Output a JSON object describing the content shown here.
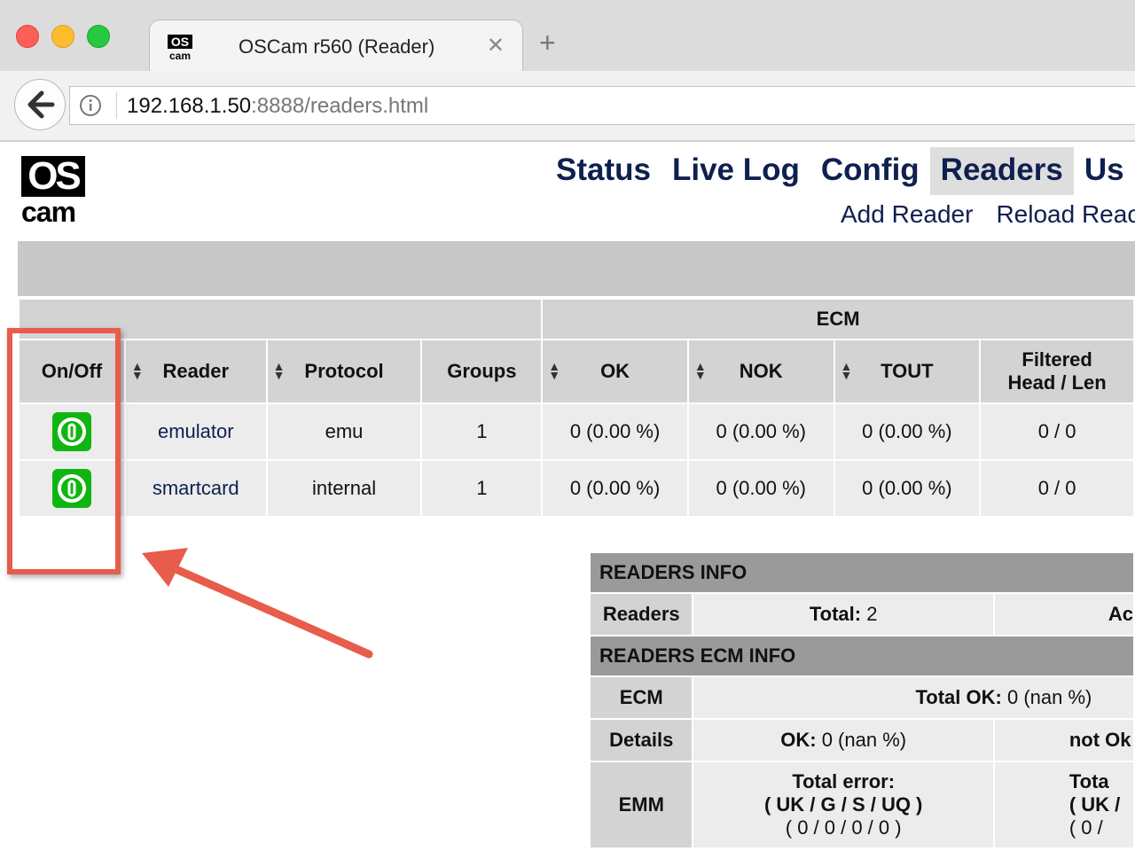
{
  "browser": {
    "tab_title": "OSCam r560 (Reader)",
    "tab_close_glyph": "✕",
    "new_tab_glyph": "+",
    "url_host": "192.168.1.50",
    "url_rest": ":8888/readers.html"
  },
  "logo": {
    "top": "OS",
    "bottom": "cam"
  },
  "nav": {
    "main": [
      "Status",
      "Live Log",
      "Config",
      "Readers",
      "Us"
    ],
    "active": "Readers",
    "sub": [
      "Add Reader",
      "Reload Reac"
    ]
  },
  "readers_table": {
    "group_header": "ECM",
    "columns": {
      "onoff": "On/Off",
      "reader": "Reader",
      "protocol": "Protocol",
      "groups": "Groups",
      "ok": "OK",
      "nok": "NOK",
      "tout": "TOUT",
      "filtered_line1": "Filtered",
      "filtered_line2": "Head / Len"
    },
    "rows": [
      {
        "reader": "emulator",
        "protocol": "emu",
        "groups": "1",
        "ok": "0 (0.00 %)",
        "nok": "0 (0.00 %)",
        "tout": "0 (0.00 %)",
        "filtered": "0 / 0"
      },
      {
        "reader": "smartcard",
        "protocol": "internal",
        "groups": "1",
        "ok": "0 (0.00 %)",
        "nok": "0 (0.00 %)",
        "tout": "0 (0.00 %)",
        "filtered": "0 / 0"
      }
    ]
  },
  "info": {
    "readers_info_title": "READERS INFO",
    "readers_label": "Readers",
    "readers_total_label": "Total:",
    "readers_total_value": "2",
    "readers_col3": "Ac",
    "ecm_info_title": "READERS ECM INFO",
    "ecm_label": "ECM",
    "ecm_total_ok_label": "Total OK:",
    "ecm_total_ok_value": "0 (nan %)",
    "details_label": "Details",
    "details_ok_label": "OK:",
    "details_ok_value": "0 (nan %)",
    "details_col3": "not Ok",
    "emm_label": "EMM",
    "emm_total_error": "Total error:",
    "emm_codes": "( UK / G / S / UQ )",
    "emm_values": "( 0 / 0 / 0 / 0 )",
    "emm_col3_line1": "Tota",
    "emm_col3_line2": "( UK /",
    "emm_col3_line3": "( 0 /"
  },
  "colors": {
    "nav_link": "#0f1f4f",
    "toggle_on": "#11b511",
    "annotation": "#e75c4a",
    "header_gray": "#d3d3d3",
    "cell_gray": "#ececec",
    "section_gray": "#9a9a9a"
  },
  "icons": {
    "back": "arrow-left-icon",
    "info": "info-circle-icon",
    "toggle": "power-toggle-icon",
    "sort": "sort-arrows-icon"
  }
}
